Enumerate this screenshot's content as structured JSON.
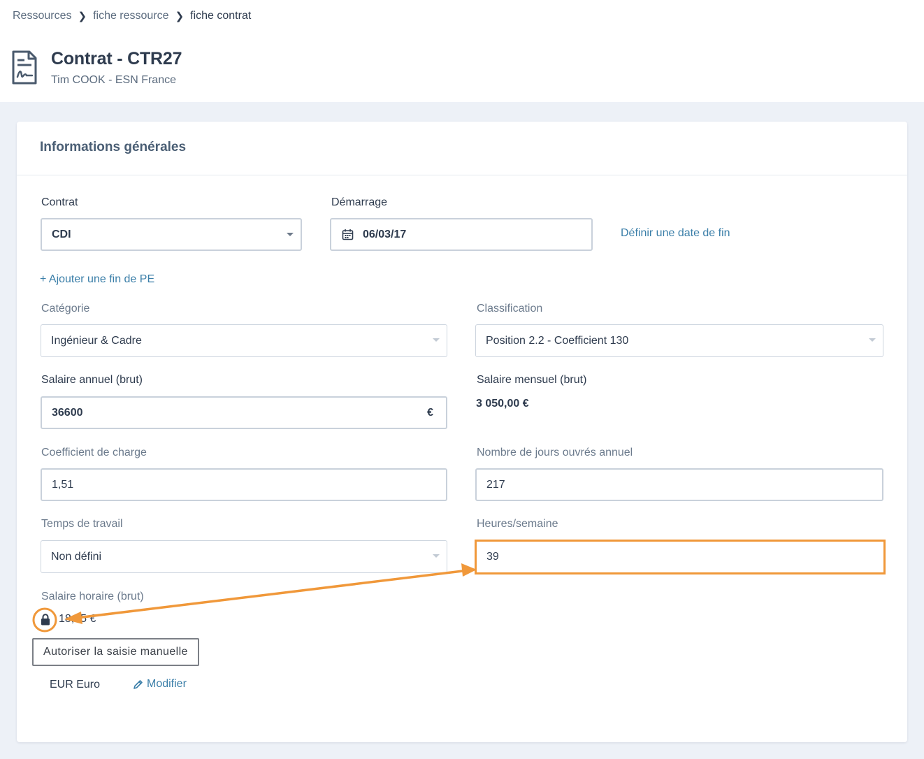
{
  "breadcrumb": {
    "items": [
      "Ressources",
      "fiche ressource"
    ],
    "current": "fiche contrat"
  },
  "header": {
    "title": "Contrat - CTR27",
    "subtitle": "Tim COOK - ESN France",
    "icon": "contract-document-icon"
  },
  "section": {
    "title": "Informations générales"
  },
  "form": {
    "contrat": {
      "label": "Contrat",
      "value": "CDI"
    },
    "demarrage": {
      "label": "Démarrage",
      "value": "06/03/17",
      "icon": "calendar-icon"
    },
    "end_date_link": "Définir une date de fin",
    "add_pe_link": "+ Ajouter une fin de PE",
    "categorie": {
      "label": "Catégorie",
      "value": "Ingénieur & Cadre"
    },
    "classification": {
      "label": "Classification",
      "value": "Position 2.2 - Coefficient 130"
    },
    "salaire_annuel": {
      "label": "Salaire annuel (brut)",
      "value": "36600",
      "suffix": "€"
    },
    "salaire_mensuel": {
      "label": "Salaire mensuel (brut)",
      "value": "3 050,00 €"
    },
    "coefficient_charge": {
      "label": "Coefficient de charge",
      "value": "1,51"
    },
    "jours_ouvres": {
      "label": "Nombre de jours ouvrés annuel",
      "value": "217"
    },
    "temps_travail": {
      "label": "Temps de travail",
      "value": "Non défini"
    },
    "heures_semaine": {
      "label": "Heures/semaine",
      "value": "39"
    },
    "salaire_horaire": {
      "label": "Salaire horaire (brut)",
      "value": "18,05 €",
      "icon": "lock-icon"
    },
    "tooltip": "Autoriser la saisie manuelle",
    "currency": "EUR Euro",
    "modify_link": "Modifier"
  },
  "colors": {
    "accent_link": "#3a7ea8",
    "annotation": "#f0983a",
    "page_bg": "#edf1f7"
  }
}
